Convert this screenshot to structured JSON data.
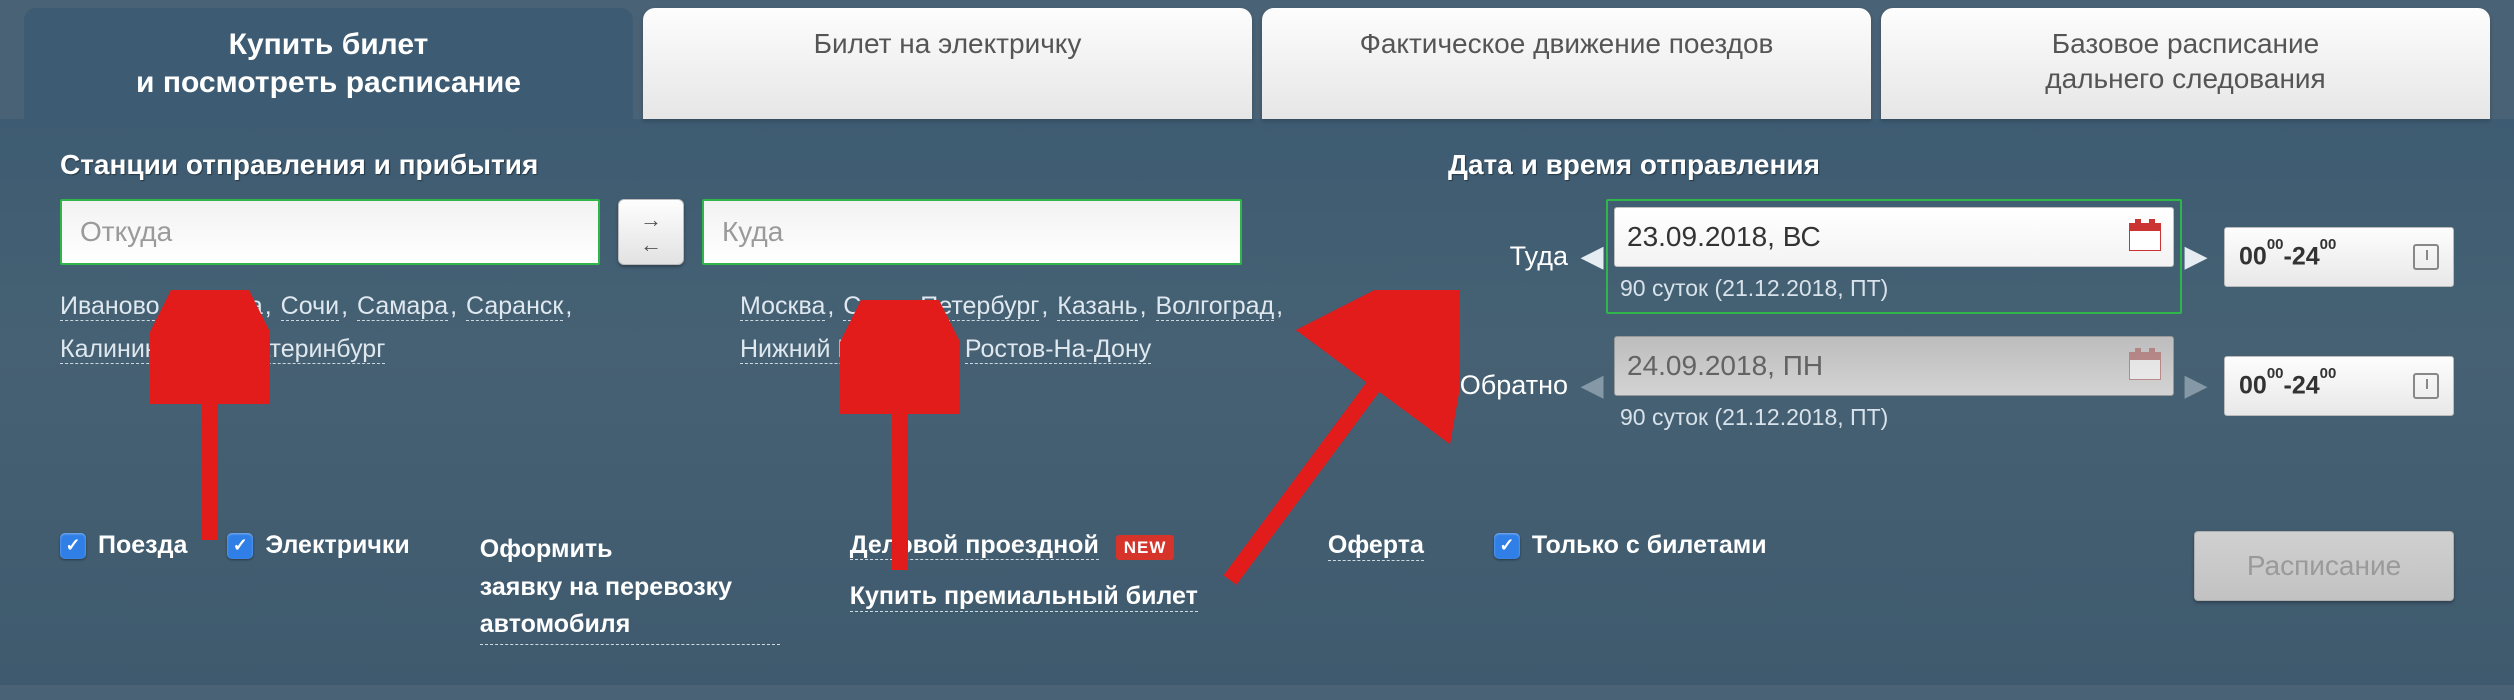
{
  "tabs": [
    {
      "label": "Купить билет\nи посмотреть расписание"
    },
    {
      "label": "Билет на электричку"
    },
    {
      "label": "Фактическое движение поездов"
    },
    {
      "label": "Базовое расписание\nдальнего следования"
    }
  ],
  "stations": {
    "title": "Станции отправления и прибытия",
    "from_placeholder": "Откуда",
    "to_placeholder": "Куда",
    "from_cities": [
      "Иваново",
      "Москва",
      "Сочи",
      "Самара",
      "Саранск",
      "Калининград",
      "Екатеринбург"
    ],
    "to_cities": [
      "Москва",
      "Санкт-Петербург",
      "Казань",
      "Волгоград",
      "Нижний Новгород",
      "Ростов-На-Дону"
    ]
  },
  "dates": {
    "title": "Дата и время отправления",
    "forward_label": "Туда",
    "return_label": "Обратно",
    "forward_value": "23.09.2018, ВС",
    "return_value": "24.09.2018, ПН",
    "note1": "90 суток (21.12.2018, ПТ)",
    "note2": "90 суток (21.12.2018, ПТ)",
    "time_from": "00",
    "time_from_min": "00",
    "time_to": "24",
    "time_to_min": "00"
  },
  "bottom": {
    "trains": "Поезда",
    "suburban": "Электрички",
    "car_link": "Оформить\nзаявку на перевозку\nавтомобиля",
    "business": "Деловой проездной",
    "new_badge": "NEW",
    "premium": "Купить премиальный билет",
    "offer": "Оферта",
    "only_tickets": "Только с билетами",
    "schedule_btn": "Расписание"
  }
}
